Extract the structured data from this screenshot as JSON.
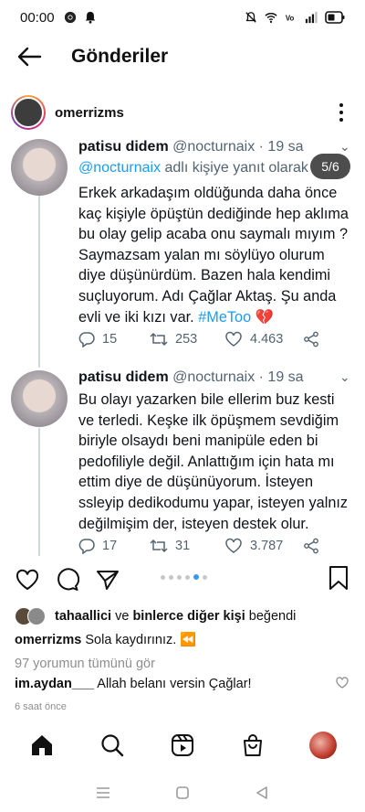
{
  "status_bar": {
    "time": "00:00"
  },
  "app_bar": {
    "title": "Gönderiler"
  },
  "post": {
    "username": "omerrizms",
    "slide_counter": "5/6"
  },
  "tweets": [
    {
      "name": "patisu didem",
      "handle": "@nocturnaix",
      "time": "· 19 sa",
      "reply_mention": "@nocturnaix",
      "reply_suffix": " adlı kişiye yanıt olarak",
      "body_lines": [
        "Erkek arkadaşım oldüğunda daha önce",
        "kaç kişiyle öpüştün dediğinde hep aklıma",
        "bu olay gelip acaba onu saymalı mıyım ?",
        "Saymazsam yalan mı söylüyo olurum",
        "diye düşünürdüm. Bazen hala kendimi",
        "suçluyorum. Adı Çağlar Aktaş. Şu anda",
        "evli ve iki kızı var. "
      ],
      "hashtag": "#MeToo",
      "replies": "15",
      "retweets": "253",
      "likes": "4.463"
    },
    {
      "name": "patisu didem",
      "handle": "@nocturnaix",
      "time": "· 19 sa",
      "body_lines": [
        "Bu olayı yazarken bile ellerim buz kesti",
        "ve terledi. Keşke ilk öpüşmem sevdiğim",
        "biriyle olsaydı beni manipüle eden bi",
        "pedofiliyle değil. Anlattığım için hata mı",
        "ettim diye de düşünüyorum. İsteyen",
        "ssleyip dedikodumu yapar, isteyen yalnız",
        "değilmişim der, isteyen destek olur."
      ],
      "replies": "17",
      "retweets": "31",
      "likes": "3.787"
    }
  ],
  "likes_line": {
    "user": "tahaallici",
    "middle": " ve ",
    "others": "binlerce diğer kişi",
    "suffix": " beğendi"
  },
  "caption": {
    "user": "omerrizms",
    "text": " Sola kaydırınız. ⏪"
  },
  "view_comments": "97 yorumun tümünü gör",
  "comment": {
    "user": "im.aydan___",
    "text": " Allah belanı versin Çağlar!"
  },
  "time_ago": "6 saat önce",
  "colors": {
    "link_blue": "#1d9bf0",
    "muted": "#536471",
    "dot_active": "#3897f0"
  }
}
